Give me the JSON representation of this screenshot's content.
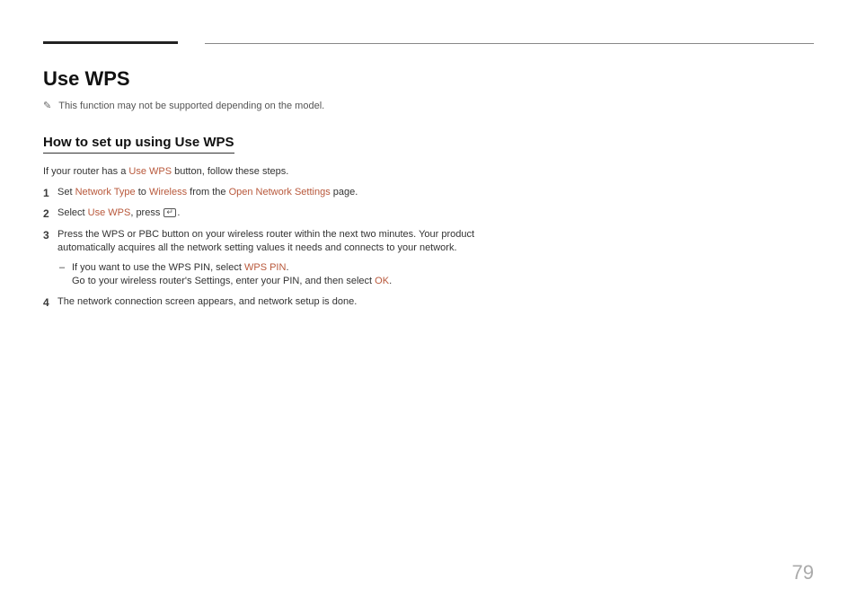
{
  "title": "Use WPS",
  "note": "This function may not be supported depending on the model.",
  "section_title": "How to set up using Use WPS",
  "intro_pre": "If your router has a ",
  "intro_hl": "Use WPS",
  "intro_post": " button, follow these steps.",
  "steps": {
    "s1_a": "Set ",
    "s1_hl1": "Network Type",
    "s1_b": " to ",
    "s1_hl2": "Wireless",
    "s1_c": " from the ",
    "s1_hl3": "Open Network Settings",
    "s1_d": " page.",
    "s2_a": "Select ",
    "s2_hl1": "Use WPS",
    "s2_b": ", press ",
    "s2_c": ".",
    "s3": "Press the WPS or PBC button on your wireless router within the next two minutes. Your product automatically acquires all the network setting values it needs and connects to your network.",
    "s3_sub_a": "If you want to use the WPS PIN, select ",
    "s3_sub_hl1": "WPS PIN",
    "s3_sub_b": ".",
    "s3_sub_c": "Go to your wireless router's Settings, enter your PIN, and then select ",
    "s3_sub_hl2": "OK",
    "s3_sub_d": ".",
    "s4": "The network connection screen appears, and network setup is done."
  },
  "page_number": "79"
}
